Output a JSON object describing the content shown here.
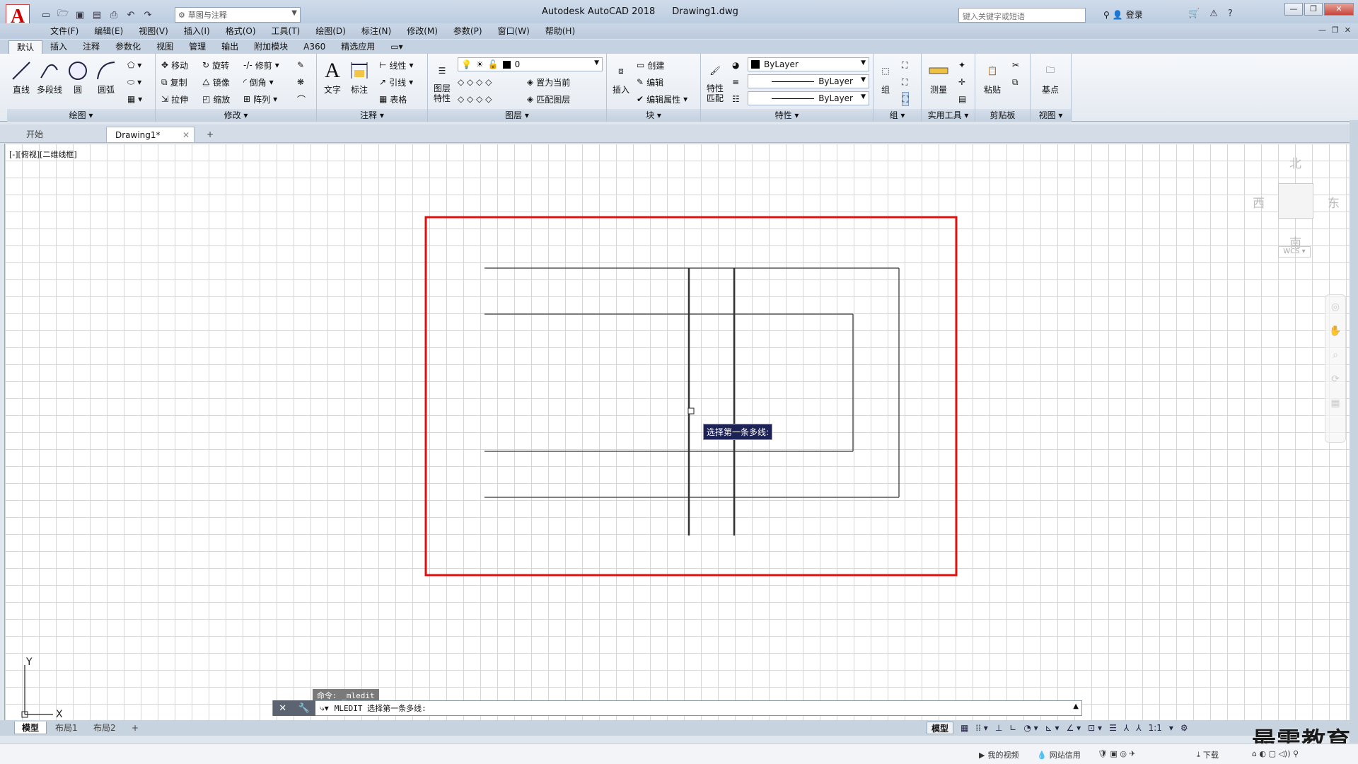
{
  "title": {
    "app": "Autodesk AutoCAD 2018",
    "file": "Drawing1.dwg"
  },
  "logo_letter": "A",
  "workspace": "草图与注释",
  "search_placeholder": "键入关键字或短语",
  "login": "登录",
  "menu": [
    "文件(F)",
    "编辑(E)",
    "视图(V)",
    "插入(I)",
    "格式(O)",
    "工具(T)",
    "绘图(D)",
    "标注(N)",
    "修改(M)",
    "参数(P)",
    "窗口(W)",
    "帮助(H)"
  ],
  "ribbon_tabs": [
    "默认",
    "插入",
    "注释",
    "参数化",
    "视图",
    "管理",
    "输出",
    "附加模块",
    "A360",
    "精选应用"
  ],
  "panels": {
    "draw": {
      "title": "绘图",
      "line": "直线",
      "polyline": "多段线",
      "circle": "圆",
      "arc": "圆弧"
    },
    "modify": {
      "title": "修改",
      "move": "移动",
      "rotate": "旋转",
      "trim": "修剪",
      "copy": "复制",
      "mirror": "镜像",
      "fillet": "倒角",
      "stretch": "拉伸",
      "scale": "缩放",
      "array": "阵列"
    },
    "annotation": {
      "title": "注释",
      "text": "文字",
      "dim": "标注",
      "linear": "线性",
      "leader": "引线",
      "table": "表格"
    },
    "layers": {
      "title": "图层",
      "props": "图层\n特性",
      "layer_value": "0",
      "set_current": "置为当前",
      "match": "匹配图层"
    },
    "block": {
      "title": "块",
      "insert": "插入",
      "create": "创建",
      "edit": "编辑",
      "edit_attr": "编辑属性"
    },
    "properties": {
      "title": "特性",
      "match": "特性\n匹配",
      "color": "ByLayer",
      "linetype": "ByLayer",
      "lineweight": "ByLayer"
    },
    "groups": {
      "title": "组",
      "group": "组"
    },
    "utilities": {
      "title": "实用工具",
      "measure": "测量"
    },
    "clipboard": {
      "title": "剪贴板",
      "paste": "粘贴"
    },
    "view": {
      "title": "视图",
      "base": "基点"
    }
  },
  "doc_tabs": {
    "start": "开始",
    "drawing": "Drawing1*",
    "new": "+"
  },
  "view_label": "[-][俯视][二维线框]",
  "viewcube": {
    "n": "北",
    "s": "南",
    "e": "东",
    "w": "西",
    "wcs": "WCS"
  },
  "tooltip": "选择第一条多线:",
  "command": {
    "history": "命令: _mledit",
    "current": "MLEDIT 选择第一条多线:"
  },
  "layout_tabs": [
    "模型",
    "布局1",
    "布局2",
    "+"
  ],
  "status": {
    "model": "模型",
    "scale": "1:1"
  },
  "bottom": {
    "video": "我的视频",
    "credit": "网站信用",
    "download": "下载"
  },
  "watermark": "最需教育",
  "ucs": {
    "x": "X",
    "y": "Y"
  },
  "colors": {
    "highlight_frame": "#e01010",
    "tooltip_bg": "#1d2256"
  }
}
